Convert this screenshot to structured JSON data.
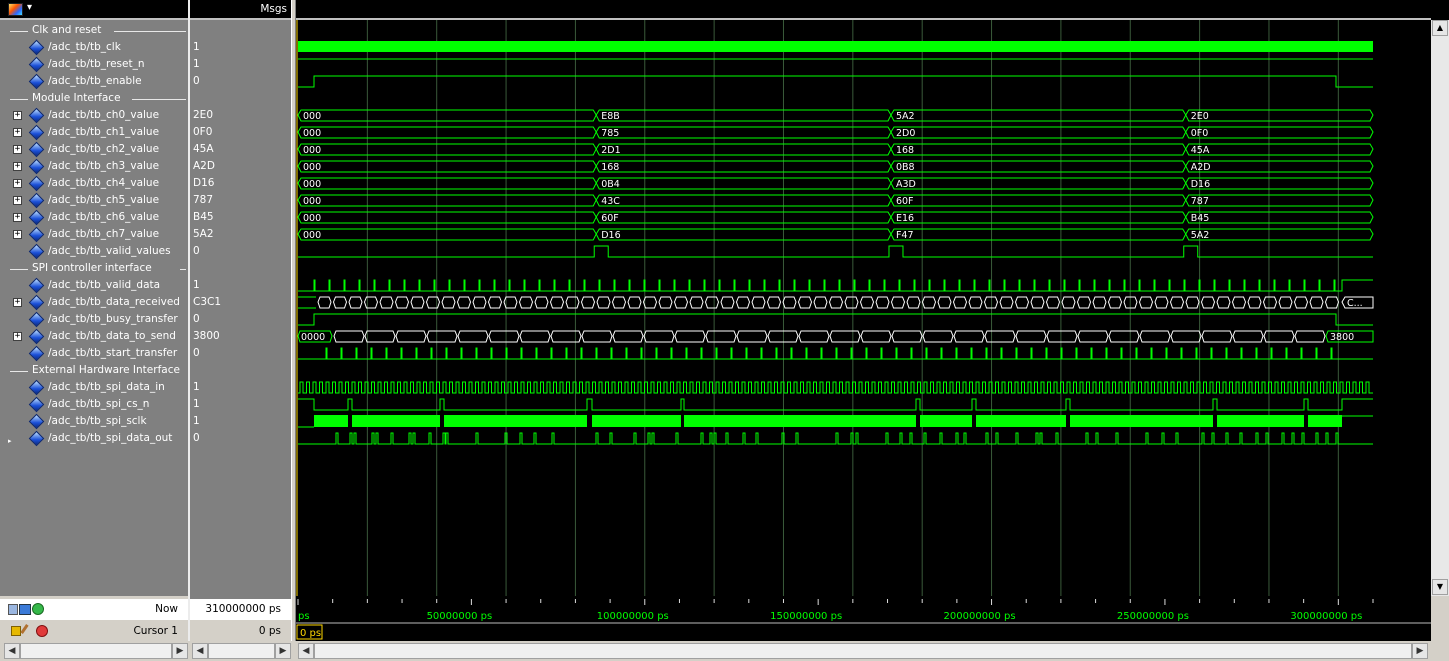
{
  "toolbar": {
    "dropdown_glyph": "▾"
  },
  "header": {
    "msgs_label": "Msgs"
  },
  "signals": [
    {
      "type": "group",
      "label": "Clk and reset"
    },
    {
      "type": "signal",
      "name": "/adc_tb/tb_clk",
      "value": "1",
      "expandable": false,
      "wave": "clk"
    },
    {
      "type": "signal",
      "name": "/adc_tb/tb_reset_n",
      "value": "1",
      "expandable": false,
      "wave": "high"
    },
    {
      "type": "signal",
      "name": "/adc_tb/tb_enable",
      "value": "0",
      "expandable": false,
      "wave": "enable"
    },
    {
      "type": "group",
      "label": "Module Interface"
    },
    {
      "type": "signal",
      "name": "/adc_tb/tb_ch0_value",
      "value": "2E0",
      "expandable": true,
      "wave": "bus",
      "segments": [
        "000",
        "E8B",
        "5A2",
        "2E0"
      ]
    },
    {
      "type": "signal",
      "name": "/adc_tb/tb_ch1_value",
      "value": "0F0",
      "expandable": true,
      "wave": "bus",
      "segments": [
        "000",
        "785",
        "2D0",
        "0F0"
      ]
    },
    {
      "type": "signal",
      "name": "/adc_tb/tb_ch2_value",
      "value": "45A",
      "expandable": true,
      "wave": "bus",
      "segments": [
        "000",
        "2D1",
        "168",
        "45A"
      ]
    },
    {
      "type": "signal",
      "name": "/adc_tb/tb_ch3_value",
      "value": "A2D",
      "expandable": true,
      "wave": "bus",
      "segments": [
        "000",
        "168",
        "0B8",
        "A2D"
      ]
    },
    {
      "type": "signal",
      "name": "/adc_tb/tb_ch4_value",
      "value": "D16",
      "expandable": true,
      "wave": "bus",
      "segments": [
        "000",
        "0B4",
        "A3D",
        "D16"
      ]
    },
    {
      "type": "signal",
      "name": "/adc_tb/tb_ch5_value",
      "value": "787",
      "expandable": true,
      "wave": "bus",
      "segments": [
        "000",
        "43C",
        "60F",
        "787"
      ]
    },
    {
      "type": "signal",
      "name": "/adc_tb/tb_ch6_value",
      "value": "B45",
      "expandable": true,
      "wave": "bus",
      "segments": [
        "000",
        "60F",
        "E16",
        "B45"
      ]
    },
    {
      "type": "signal",
      "name": "/adc_tb/tb_ch7_value",
      "value": "5A2",
      "expandable": true,
      "wave": "bus",
      "segments": [
        "000",
        "D16",
        "F47",
        "5A2"
      ]
    },
    {
      "type": "signal",
      "name": "/adc_tb/tb_valid_values",
      "value": "0",
      "expandable": false,
      "wave": "valid_values"
    },
    {
      "type": "group",
      "label": "SPI controller interface"
    },
    {
      "type": "signal",
      "name": "/adc_tb/tb_valid_data",
      "value": "1",
      "expandable": false,
      "wave": "pulses_thin"
    },
    {
      "type": "signal",
      "name": "/adc_tb/tb_data_received",
      "value": "C3C1",
      "expandable": true,
      "wave": "bus_dense",
      "last_label": "C..."
    },
    {
      "type": "signal",
      "name": "/adc_tb/tb_busy_transfer",
      "value": "0",
      "expandable": false,
      "wave": "busy"
    },
    {
      "type": "signal",
      "name": "/adc_tb/tb_data_to_send",
      "value": "3800",
      "expandable": true,
      "wave": "bus_medium",
      "first_label": "0000",
      "last_label": "3800"
    },
    {
      "type": "signal",
      "name": "/adc_tb/tb_start_transfer",
      "value": "0",
      "expandable": false,
      "wave": "pulses_low"
    },
    {
      "type": "group",
      "label": "External Hardware Interface"
    },
    {
      "type": "signal",
      "name": "/adc_tb/tb_spi_data_in",
      "value": "1",
      "expandable": false,
      "wave": "square"
    },
    {
      "type": "signal",
      "name": "/adc_tb/tb_spi_cs_n",
      "value": "1",
      "expandable": false,
      "wave": "cs"
    },
    {
      "type": "signal",
      "name": "/adc_tb/tb_spi_sclk",
      "value": "1",
      "expandable": false,
      "wave": "sclk"
    },
    {
      "type": "signal",
      "name": "/adc_tb/tb_spi_data_out",
      "value": "0",
      "expandable": false,
      "wave": "data_out"
    }
  ],
  "status": {
    "now_label": "Now",
    "now_value": "310000000 ps",
    "cursor_label": "Cursor 1",
    "cursor_value": "0 ps",
    "cursor_marker": "0 ps"
  },
  "timeline": {
    "start_label": "ps",
    "ticks": [
      "50000000 ps",
      "100000000 ps",
      "150000000 ps",
      "200000000 ps",
      "250000000 ps",
      "300000000 ps"
    ]
  },
  "colors": {
    "wave": "#00ff00",
    "grid": "#3a5a3a",
    "text": "#ffffff",
    "cursor": "#ffd800"
  }
}
